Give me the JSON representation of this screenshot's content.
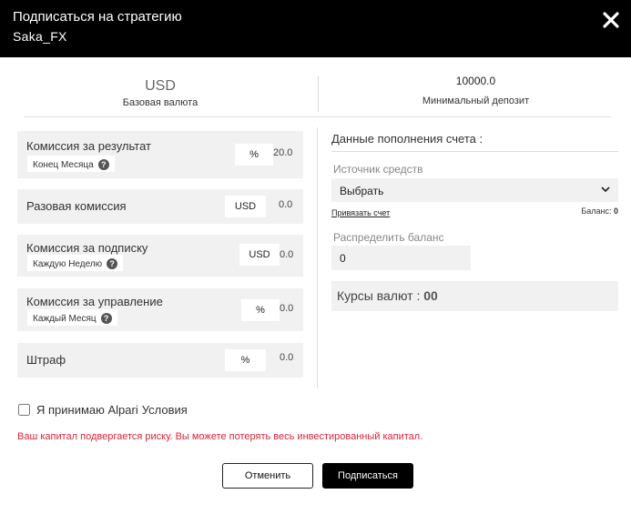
{
  "header": {
    "title": "Подписаться на стратегию",
    "subtitle": "Saka_FX"
  },
  "summary": {
    "currency_value": "USD",
    "currency_label": "Базовая валюта",
    "min_deposit_value": "10000.0",
    "min_deposit_label": "Минимальный депозит"
  },
  "fees": [
    {
      "label": "Комиссия за результат",
      "chip": "Конец Месяца",
      "unit": "%",
      "value": "20.0"
    },
    {
      "label": "Разовая комиссия",
      "chip": "",
      "unit": "USD",
      "value": "0.0"
    },
    {
      "label": "Комиссия за подписку",
      "chip": "Каждую Неделю",
      "unit": "USD",
      "value": "0.0"
    },
    {
      "label": "Комиссия за управление",
      "chip": "Каждый Месяц",
      "unit": "%",
      "value": "0.0"
    },
    {
      "label": "Штраф",
      "chip": "",
      "unit": "%",
      "value": "0.0"
    }
  ],
  "funding": {
    "title": "Данные пополнения счета :",
    "source_label": "Источник средств",
    "source_selected": "Выбрать",
    "link_account": "Привязать счет",
    "balance_label": "Баланс:",
    "balance_value": "0",
    "distribute_label": "Распределить баланс",
    "distribute_value": "0",
    "rates_label": "Курсы валют :",
    "rates_value": "00"
  },
  "terms": {
    "accept_text": "Я принимаю Alpari",
    "accept_link": "Условия"
  },
  "risk_warning": "Ваш капитал подвергается риску. Вы можете потерять весь инвестированный капитал.",
  "buttons": {
    "cancel": "Отменить",
    "subscribe": "Подписаться"
  },
  "icons": {
    "close": "close-icon",
    "help": "question-icon",
    "chevron": "chevron-down-icon"
  }
}
